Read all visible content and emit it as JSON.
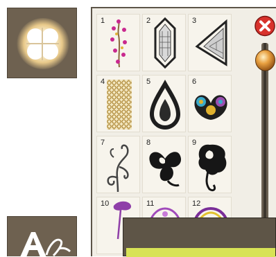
{
  "panel": {
    "designs": [
      {
        "number": "1",
        "name": "floral-sprig-design"
      },
      {
        "number": "2",
        "name": "lattice-hexagon-design"
      },
      {
        "number": "3",
        "name": "lace-triangle-design"
      },
      {
        "number": "4",
        "name": "cross-stitch-block-design"
      },
      {
        "number": "5",
        "name": "lace-teardrop-design"
      },
      {
        "number": "6",
        "name": "peacock-fan-design"
      },
      {
        "number": "7",
        "name": "swirl-vine-design"
      },
      {
        "number": "8",
        "name": "black-flower-design"
      },
      {
        "number": "9",
        "name": "black-tulip-design"
      },
      {
        "number": "10",
        "name": "purple-thistle-design"
      },
      {
        "number": "11",
        "name": "purple-circle-design"
      },
      {
        "number": "12",
        "name": "purple-yellow-circle-design"
      }
    ]
  },
  "icons": {
    "top_button": "glow-flower-icon",
    "bottom_button": "font-letter-icon",
    "close": "close-icon",
    "scroll": "scroll-thumb"
  },
  "colors": {
    "frame": "#6e6150",
    "panel": "#f1eee6",
    "close": "#d8322c",
    "thumb": "#e8a040",
    "yellow_bar": "#d8e356"
  }
}
